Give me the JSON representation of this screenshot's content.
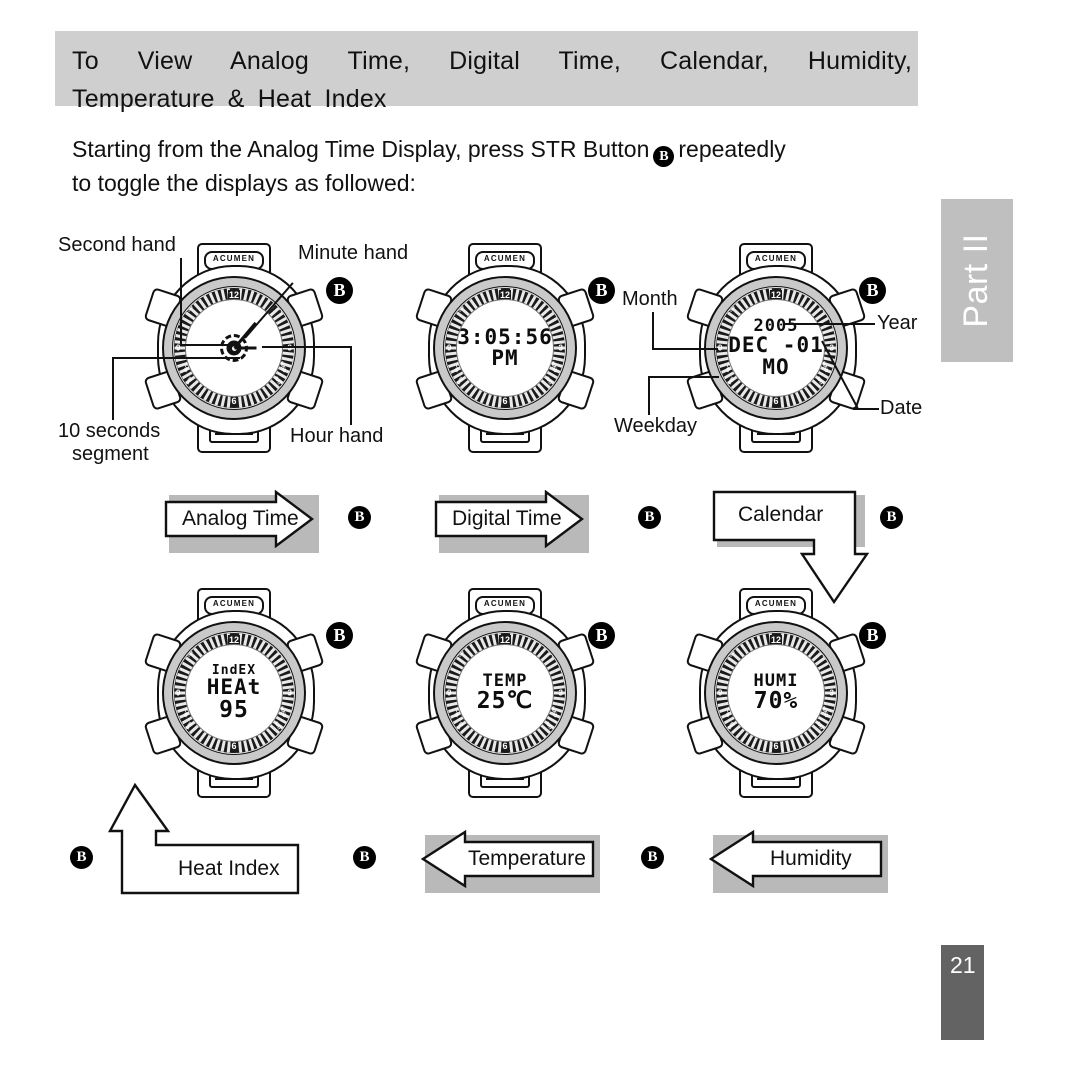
{
  "header": {
    "title_line1": "To View Analog Time, Digital Time, Calendar, Humidity,",
    "title_line2": "Temperature & Heat Index"
  },
  "intro": {
    "line1_before": "Starting from the Analog Time Display, press STR Button",
    "button_glyph": "B",
    "line1_after": "repeatedly",
    "line2": "to toggle the displays as followed:"
  },
  "sidebar": {
    "part_label": "Part II",
    "page_number": "21"
  },
  "watch_brand": "ACUMEN",
  "dial_micro": {
    "topleft": "SU",
    "topright": "TH",
    "left9": "9",
    "right3": "3",
    "lowleft1": "MON",
    "lowleft2": "FRI",
    "lowright1": "WED",
    "lowright2": "SAT",
    "twelve": "12",
    "six": "6"
  },
  "watches": [
    {
      "id": "analog-time",
      "mode": "analog",
      "lcd": []
    },
    {
      "id": "digital-time",
      "mode": "lcd",
      "lcd": [
        {
          "text": "3:05:56",
          "size": "lg"
        },
        {
          "text": "PM",
          "size": "lg"
        }
      ]
    },
    {
      "id": "calendar",
      "mode": "lcd",
      "lcd": [
        {
          "text": "2005",
          "size": "md"
        },
        {
          "text": "DEC -01",
          "size": "lg"
        },
        {
          "text": "MO",
          "size": "lg"
        }
      ]
    },
    {
      "id": "heat-index",
      "mode": "lcd",
      "lcd": [
        {
          "text": "IndEX",
          "size": "sm"
        },
        {
          "text": "HEAt",
          "size": "lg"
        },
        {
          "text": "95",
          "size": "xl"
        }
      ]
    },
    {
      "id": "temperature",
      "mode": "lcd",
      "lcd": [
        {
          "text": "TEMP",
          "size": "md"
        },
        {
          "text": "25℃",
          "size": "xl"
        }
      ]
    },
    {
      "id": "humidity",
      "mode": "lcd",
      "lcd": [
        {
          "text": "HUMI",
          "size": "md"
        },
        {
          "text": "70%",
          "size": "xl"
        }
      ]
    }
  ],
  "callouts": {
    "second_hand": "Second hand",
    "minute_hand": "Minute hand",
    "hour_hand": "Hour hand",
    "ten_seconds_l1": "10 seconds",
    "ten_seconds_l2": "segment",
    "month": "Month",
    "year": "Year",
    "weekday": "Weekday",
    "date": "Date"
  },
  "flow": {
    "analog_time": "Analog Time",
    "digital_time": "Digital Time",
    "calendar": "Calendar",
    "heat_index": "Heat Index",
    "temperature": "Temperature",
    "humidity": "Humidity",
    "button_glyph": "B"
  }
}
